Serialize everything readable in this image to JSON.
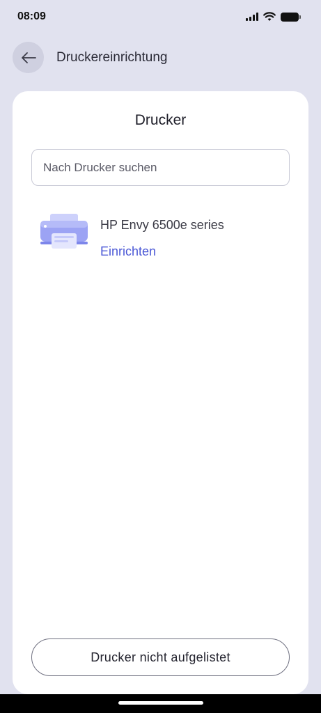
{
  "status_bar": {
    "time": "08:09",
    "icons": [
      "signal-icon",
      "wifi-icon",
      "battery-icon"
    ]
  },
  "header": {
    "back_icon": "arrow-left-icon",
    "title": "Druckereinrichtung"
  },
  "card": {
    "title": "Drucker",
    "search": {
      "placeholder": "Nach Drucker suchen",
      "value": ""
    },
    "printers": [
      {
        "icon": "printer-icon",
        "name": "HP Envy 6500e series",
        "action_label": "Einrichten"
      }
    ],
    "not_listed_label": "Drucker nicht aufgelistet"
  },
  "colors": {
    "background": "#e1e2ef",
    "card": "#ffffff",
    "accent": "#4b58d6",
    "printer_icon": "#8f97f0"
  }
}
